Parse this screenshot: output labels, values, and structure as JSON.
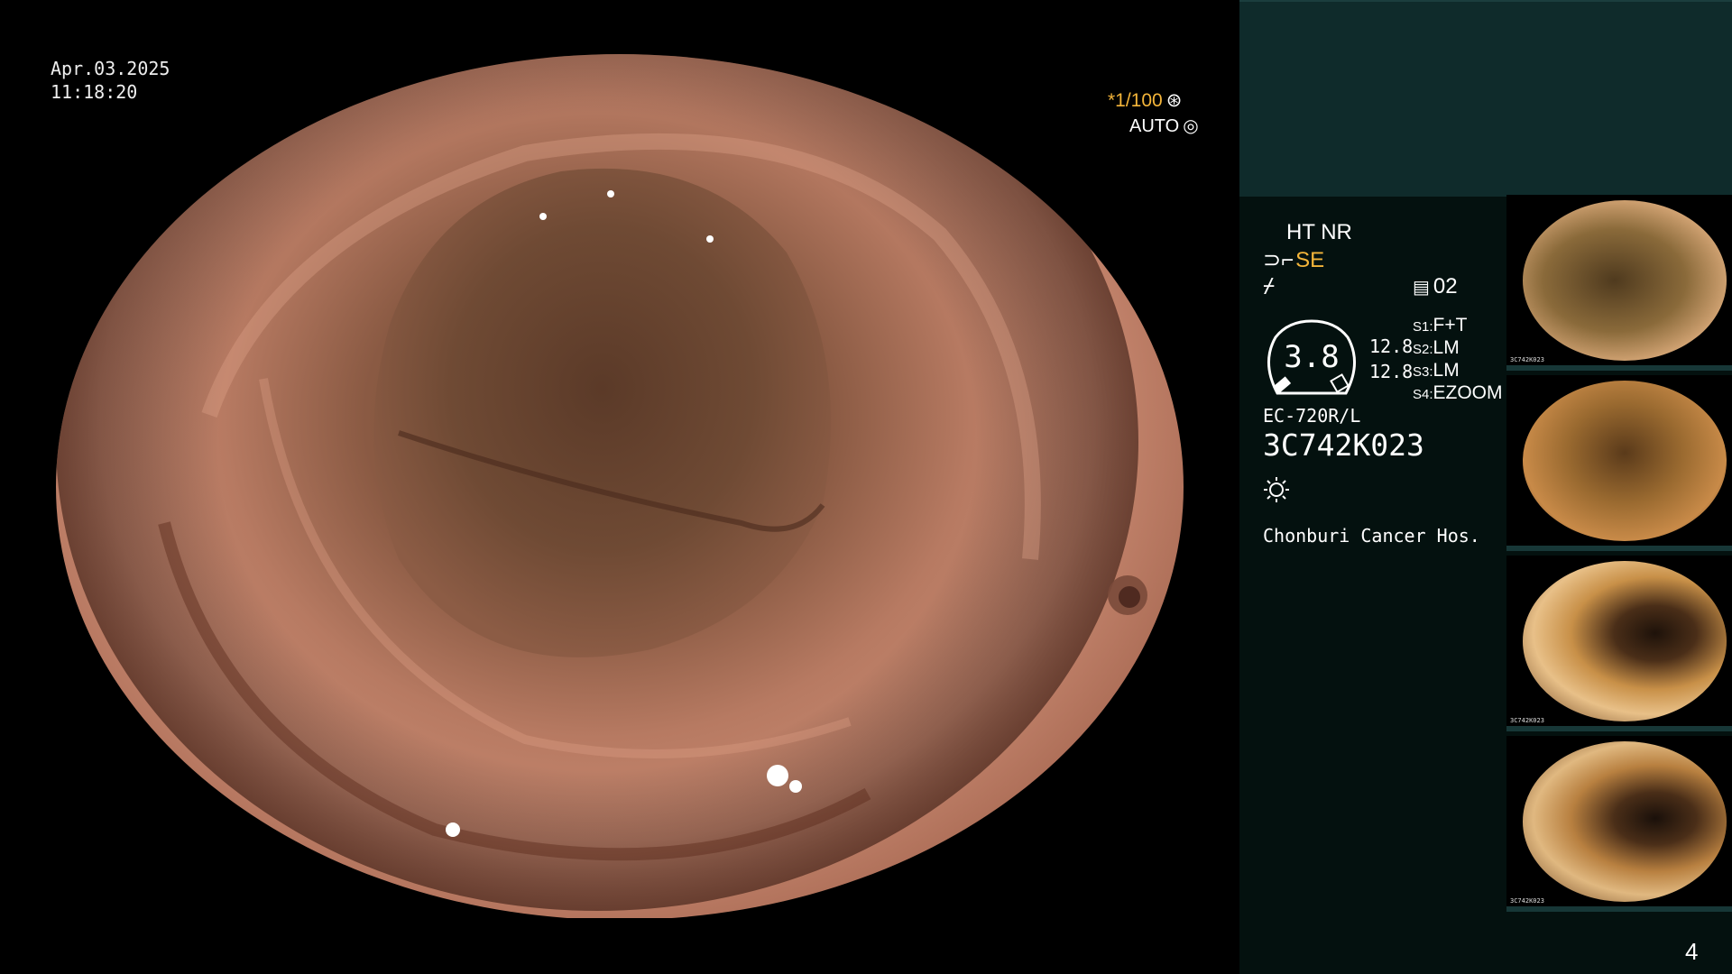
{
  "overlay": {
    "date": "Apr.03.2025",
    "time": "11:18:20",
    "shutter_value": "*1/100",
    "shutter_icon": "aperture-icon",
    "auto_label": "AUTO",
    "auto_icon": "iris-icon"
  },
  "info_panel": {
    "ht_nr": "HT NR",
    "se_icon": "structure-enhance-icon",
    "se_label": "SE",
    "curve_icon": "color-curve-icon",
    "memory_icon": "memory-card-icon",
    "memory_value": "02",
    "gauge_value": "3.8",
    "aux_values": [
      "12.8",
      "12.8"
    ],
    "switches": [
      {
        "key": "S1:",
        "value": "F+T"
      },
      {
        "key": "S2:",
        "value": "LM"
      },
      {
        "key": "S3:",
        "value": "LM"
      },
      {
        "key": "S4:",
        "value": "EZOOM"
      }
    ],
    "scope_model": "EC-720R/L",
    "scope_serial": "3C742K023",
    "light_icon": "light-source-icon",
    "hospital": "Chonburi Cancer Hos."
  },
  "thumbnails": [
    {
      "label": "3C742K023"
    },
    {
      "label": ""
    },
    {
      "label": "3C742K023"
    },
    {
      "label": "3C742K023"
    }
  ],
  "page_number": "4",
  "colors": {
    "accent_orange": "#f4b53a",
    "panel_top": "#0f2b2b",
    "panel_bg": "#04110f"
  }
}
